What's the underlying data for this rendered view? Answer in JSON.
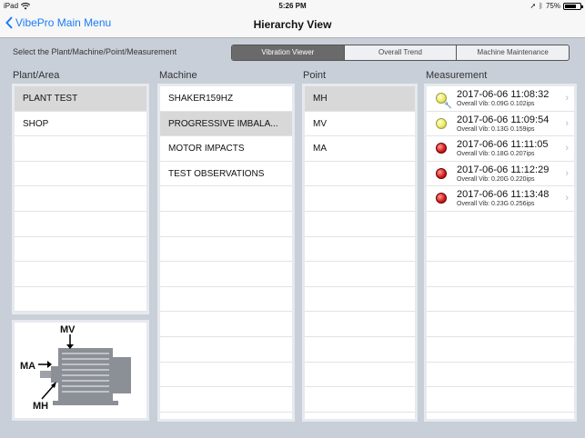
{
  "status": {
    "device": "iPad",
    "time": "5:26 PM",
    "battery": "75%",
    "battery_level": 0.75
  },
  "nav": {
    "back_label": "VibePro Main Menu",
    "title": "Hierarchy View"
  },
  "toolbar": {
    "prompt": "Select the Plant/Machine/Point/Measurement",
    "segments": [
      "Vibration Viewer",
      "Overall Trend",
      "Machine Maintenance"
    ]
  },
  "columns": {
    "plant": {
      "header": "Plant/Area",
      "items": [
        "PLANT TEST",
        "SHOP"
      ]
    },
    "machine": {
      "header": "Machine",
      "items": [
        "SHAKER159HZ",
        "PROGRESSIVE IMBALA...",
        "MOTOR IMPACTS",
        "TEST OBSERVATIONS"
      ]
    },
    "point": {
      "header": "Point",
      "items": [
        "MH",
        "MV",
        "MA"
      ]
    },
    "measurement": {
      "header": "Measurement",
      "items": [
        {
          "timestamp": "2017-06-06 11:08:32",
          "overall": "Overall Vib: 0.09G 0.102ips",
          "status": "yellow"
        },
        {
          "timestamp": "2017-06-06 11:09:54",
          "overall": "Overall Vib: 0.13G 0.159ips",
          "status": "yellow"
        },
        {
          "timestamp": "2017-06-06 11:11:05",
          "overall": "Overall Vib: 0.18G 0.207ips",
          "status": "red"
        },
        {
          "timestamp": "2017-06-06 11:12:29",
          "overall": "Overall Vib: 0.20G 0.220ips",
          "status": "red"
        },
        {
          "timestamp": "2017-06-06 11:13:48",
          "overall": "Overall Vib: 0.23G 0.256ips",
          "status": "red"
        }
      ]
    }
  },
  "diagram": {
    "labels": [
      "MV",
      "MA",
      "MH"
    ]
  },
  "colors": {
    "accent": "#1a7cf5",
    "segment_active": "#6a6a6a",
    "selected_row": "#d8d8d8"
  }
}
